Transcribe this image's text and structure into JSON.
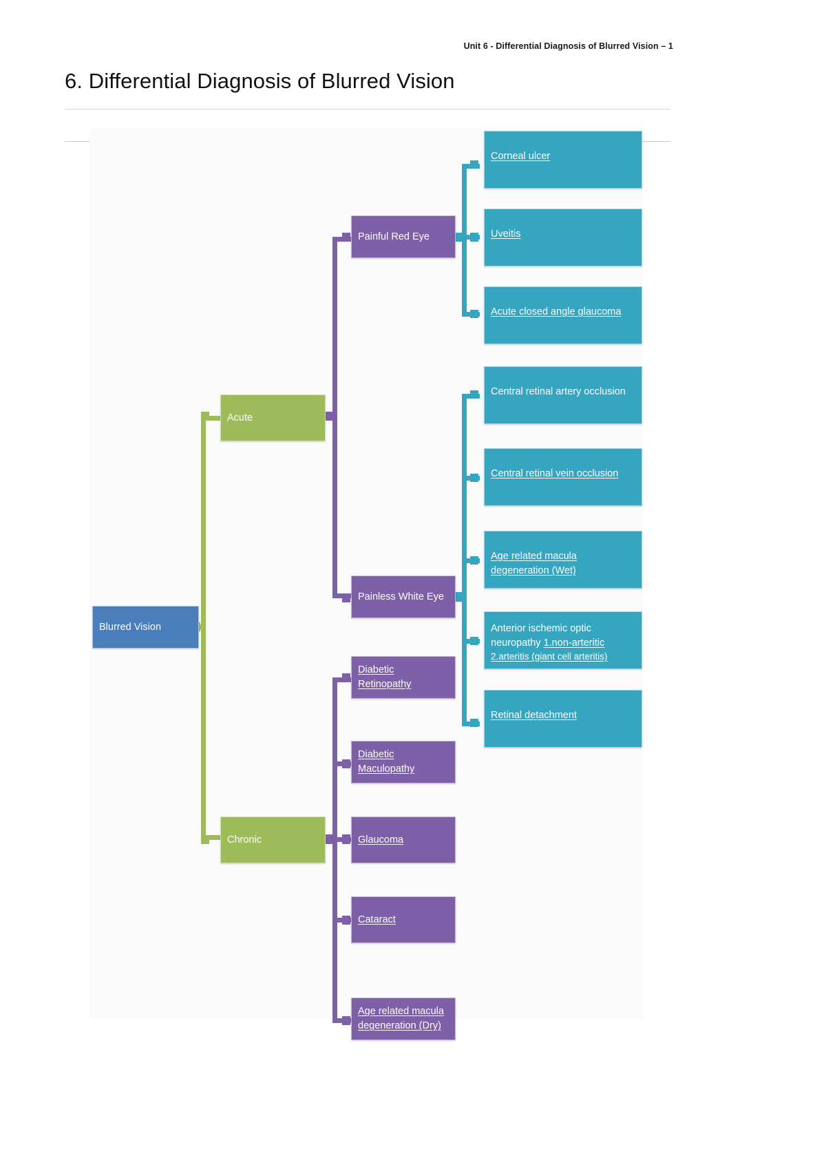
{
  "header": {
    "running_head": "Unit 6 - Differential Diagnosis of Blurred Vision – 1"
  },
  "title": "6. Differential Diagnosis of Blurred Vision",
  "colors": {
    "root": "#4a7ebb",
    "level1": "#9dbb58",
    "level2": "#7e60a8",
    "leaf": "#36a5bf",
    "canvas": "#fbfbfb",
    "rule": "#d5d5d5"
  },
  "chart_data": {
    "type": "diagram",
    "subtype": "horizontal-tree-mindmap",
    "title": "6. Differential Diagnosis of Blurred Vision",
    "root": "Blurred Vision",
    "levels": 4,
    "nodes": {
      "root": {
        "label": "Blurred Vision",
        "level": 0,
        "color": "#4a7ebb"
      },
      "acute": {
        "label": "Acute",
        "level": 1,
        "color": "#9dbb58"
      },
      "chronic": {
        "label": "Chronic",
        "level": 1,
        "color": "#9dbb58"
      },
      "painful_red_eye": {
        "label": "Painful Red Eye",
        "level": 2,
        "color": "#7e60a8"
      },
      "painless_white_eye": {
        "label": "Painless White Eye",
        "level": 2,
        "color": "#7e60a8"
      },
      "corneal_ulcer": {
        "label": "Corneal ulcer",
        "level": 3,
        "color": "#36a5bf",
        "underline": true
      },
      "uveitis": {
        "label": "Uveitis",
        "level": 3,
        "color": "#36a5bf",
        "underline": true
      },
      "acute_closed_angle_glaucoma": {
        "label": "Acute closed angle glaucoma",
        "level": 3,
        "color": "#36a5bf",
        "underline": true
      },
      "crao": {
        "label": "Central retinal artery occlusion",
        "level": 3,
        "color": "#36a5bf",
        "underline": false
      },
      "crvo": {
        "label": "Central retinal vein occlusion",
        "level": 3,
        "color": "#36a5bf",
        "underline": true
      },
      "armd_wet": {
        "label": "Age related macula degeneration (Wet)",
        "level": 3,
        "color": "#36a5bf",
        "underline": true
      },
      "aion": {
        "label": "Anterior ischemic optic neuropathy 1.non-arteritic 2.arteritis (giant cell arteritis)",
        "level": 3,
        "color": "#36a5bf",
        "underline": "partial"
      },
      "retinal_detachment": {
        "label": "Retinal detachment",
        "level": 3,
        "color": "#36a5bf",
        "underline": true
      },
      "diabetic_retinopathy": {
        "label": "Diabetic Retinopathy",
        "level": 2,
        "color": "#7e60a8",
        "underline": true
      },
      "diabetic_maculopathy": {
        "label": "Diabetic Maculopathy",
        "level": 2,
        "color": "#7e60a8",
        "underline": true
      },
      "glaucoma": {
        "label": "Glaucoma",
        "level": 2,
        "color": "#7e60a8",
        "underline": true
      },
      "cataract": {
        "label": "Cataract",
        "level": 2,
        "color": "#7e60a8",
        "underline": true
      },
      "armd_dry": {
        "label": "Age related macula degeneration (Dry)",
        "level": 2,
        "color": "#7e60a8",
        "underline": true
      }
    },
    "edges": [
      [
        "root",
        "acute"
      ],
      [
        "root",
        "chronic"
      ],
      [
        "acute",
        "painful_red_eye"
      ],
      [
        "acute",
        "painless_white_eye"
      ],
      [
        "painful_red_eye",
        "corneal_ulcer"
      ],
      [
        "painful_red_eye",
        "uveitis"
      ],
      [
        "painful_red_eye",
        "acute_closed_angle_glaucoma"
      ],
      [
        "painless_white_eye",
        "crao"
      ],
      [
        "painless_white_eye",
        "crvo"
      ],
      [
        "painless_white_eye",
        "armd_wet"
      ],
      [
        "painless_white_eye",
        "aion"
      ],
      [
        "painless_white_eye",
        "retinal_detachment"
      ],
      [
        "chronic",
        "diabetic_retinopathy"
      ],
      [
        "chronic",
        "diabetic_maculopathy"
      ],
      [
        "chronic",
        "glaucoma"
      ],
      [
        "chronic",
        "cataract"
      ],
      [
        "chronic",
        "armd_dry"
      ]
    ]
  },
  "diagram": {
    "root": {
      "label": "Blurred Vision"
    },
    "acute": {
      "label": "Acute"
    },
    "chronic": {
      "label": "Chronic"
    },
    "painful_red_eye": {
      "label": "Painful Red Eye"
    },
    "painless_white_eye": {
      "label": "Painless White Eye"
    },
    "corneal_ulcer": {
      "label": "Corneal ulcer"
    },
    "uveitis": {
      "label": "Uveitis"
    },
    "acute_closed_angle_glaucoma": {
      "label": "Acute closed angle glaucoma"
    },
    "crao": {
      "label": "Central retinal artery occlusion"
    },
    "crvo": {
      "label": "Central retinal vein occlusion"
    },
    "armd_wet": {
      "label": "Age related macula degeneration (Wet)"
    },
    "aion_line1": {
      "label": "Anterior ischemic optic"
    },
    "aion_line2_plain": {
      "label": "neuropathy "
    },
    "aion_line2_underlined": {
      "label": "1.non-arteritic"
    },
    "aion_line3": {
      "label": "2.arteritis (giant cell arteritis)"
    },
    "retinal_detachment": {
      "label": "Retinal detachment"
    },
    "diabetic_retinopathy": {
      "label": "Diabetic Retinopathy"
    },
    "diabetic_maculopathy": {
      "label": "Diabetic Maculopathy"
    },
    "glaucoma": {
      "label": "Glaucoma"
    },
    "cataract": {
      "label": "Cataract"
    },
    "armd_dry": {
      "label": "Age related macula degeneration (Dry)"
    }
  }
}
